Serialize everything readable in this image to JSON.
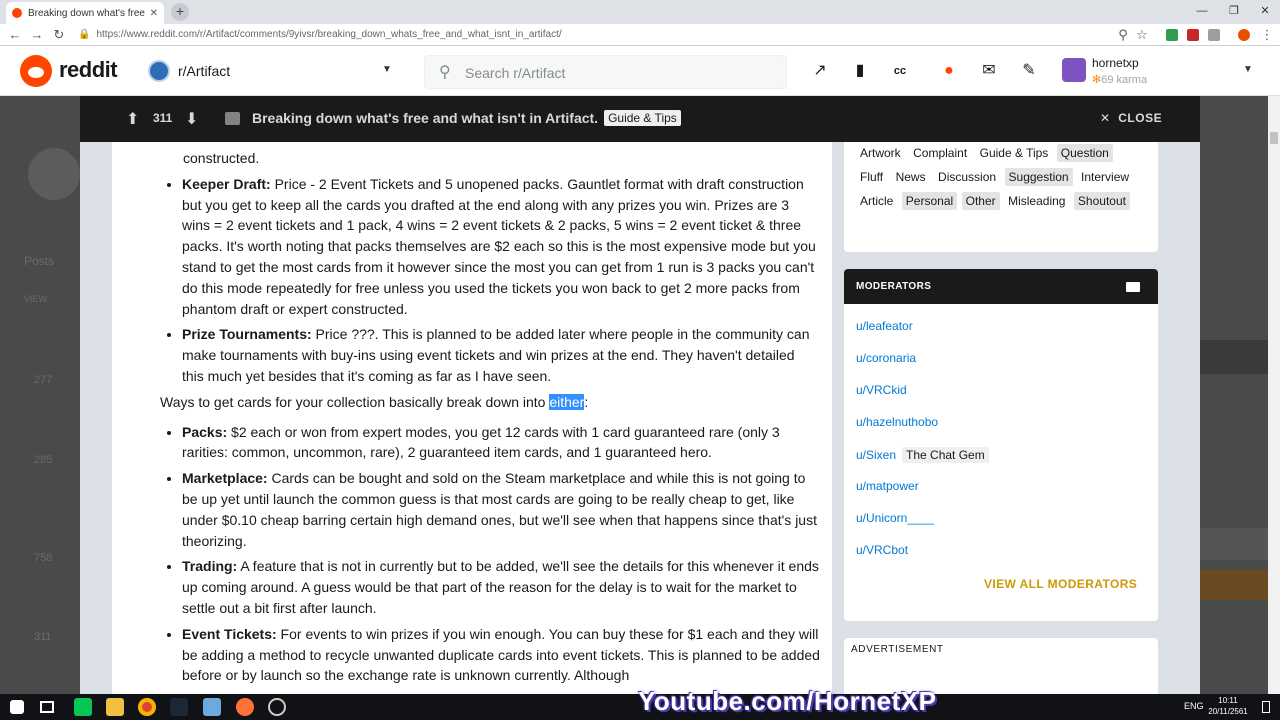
{
  "browser": {
    "tab_title": "Breaking down what's free and w",
    "url": "https://www.reddit.com/r/Artifact/comments/9yivsr/breaking_down_whats_free_and_what_isnt_in_artifact/"
  },
  "header": {
    "logo_text": "reddit",
    "subreddit": "r/Artifact",
    "search_placeholder": "Search r/Artifact",
    "username": "hornetxp",
    "karma": "69 karma"
  },
  "post": {
    "score": "311",
    "title": "Breaking down what's free and what isn't in Artifact.",
    "flair": "Guide & Tips",
    "close_label": "CLOSE"
  },
  "body": {
    "top_fragment": "constructed.",
    "list1": [
      {
        "term": "Keeper Draft:",
        "text": " Price - 2 Event Tickets and 5 unopened packs. Gauntlet format with draft construction but you get to keep all the cards you drafted at the end along with any prizes you win. Prizes are 3 wins = 2 event tickets and 1 pack, 4 wins = 2 event tickets & 2 packs, 5 wins = 2 event ticket & three packs. It's worth noting that packs themselves are $2 each so this is the most expensive mode but you stand to get the most cards from it however since the most you can get from 1 run is 3 packs you can't do this mode repeatedly for free unless you used the tickets you won back to get 2 more packs from phantom draft or expert constructed."
      },
      {
        "term": "Prize Tournaments:",
        "text": " Price ???. This is planned to be added later where people in the community can make tournaments with buy-ins using event tickets and win prizes at the end. They haven't detailed this much yet besides that it's coming as far as I have seen."
      }
    ],
    "para_before": "Ways to get cards for your collection basically break down into ",
    "para_selected": "either",
    "para_after": ":",
    "list2": [
      {
        "term": "Packs:",
        "text": " $2 each or won from expert modes, you get 12 cards with 1 card guaranteed rare (only 3 rarities: common, uncommon, rare), 2 guaranteed item cards, and 1 guaranteed hero."
      },
      {
        "term": "Marketplace:",
        "text": " Cards can be bought and sold on the Steam marketplace and while this is not going to be up yet until launch the common guess is that most cards are going to be really cheap to get, like under $0.10 cheap barring certain high demand ones, but we'll see when that happens since that's just theorizing."
      },
      {
        "term": "Trading:",
        "text": " A feature that is not in currently but to be added, we'll see the details for this whenever it ends up coming around. A guess would be that part of the reason for the delay is to wait for the market to settle out a bit first after launch."
      },
      {
        "term": "Event Tickets:",
        "text": " For events to win prizes if you win enough. You can buy these for $1 each and they will be adding a method to recycle unwanted duplicate cards into event tickets. This is planned to be added before or by launch so the exchange rate is unknown currently. Although"
      }
    ]
  },
  "sidebar": {
    "flairs": [
      {
        "label": "Artwork",
        "hl": false
      },
      {
        "label": "Complaint",
        "hl": false
      },
      {
        "label": "Guide & Tips",
        "hl": false
      },
      {
        "label": "Question",
        "hl": true
      },
      {
        "label": "Fluff",
        "hl": false
      },
      {
        "label": "News",
        "hl": false
      },
      {
        "label": "Discussion",
        "hl": false
      },
      {
        "label": "Suggestion",
        "hl": true
      },
      {
        "label": "Interview",
        "hl": false
      },
      {
        "label": "Article",
        "hl": false
      },
      {
        "label": "Personal",
        "hl": true
      },
      {
        "label": "Other",
        "hl": true
      },
      {
        "label": "Misleading",
        "hl": false
      },
      {
        "label": "Shoutout",
        "hl": true
      }
    ],
    "moderators_title": "MODERATORS",
    "moderators": [
      {
        "name": "u/leafeator",
        "flair": ""
      },
      {
        "name": "u/coronaria",
        "flair": ""
      },
      {
        "name": "u/VRCkid",
        "flair": ""
      },
      {
        "name": "u/hazelnuthobo",
        "flair": ""
      },
      {
        "name": "u/Sixen",
        "flair": "The Chat Gem"
      },
      {
        "name": "u/matpower",
        "flair": ""
      },
      {
        "name": "u/Unicorn____",
        "flair": ""
      },
      {
        "name": "u/VRCbot",
        "flair": ""
      }
    ],
    "view_all": "VIEW ALL MODERATORS",
    "ad_label": "ADVERTISEMENT"
  },
  "background": {
    "tab_label": "Posts",
    "view_label": "VIEW",
    "scores": [
      "277",
      "285",
      "758",
      "311"
    ]
  },
  "taskbar": {
    "watermark": "Youtube.com/HornetXP",
    "lang": "ENG",
    "time": "10:11",
    "date": "20/11/2561"
  },
  "colors": {
    "reddit_orange": "#ff4500",
    "link_blue": "#0079d3",
    "gold": "#cc9a06",
    "dark_bar": "#1a1a1b"
  }
}
